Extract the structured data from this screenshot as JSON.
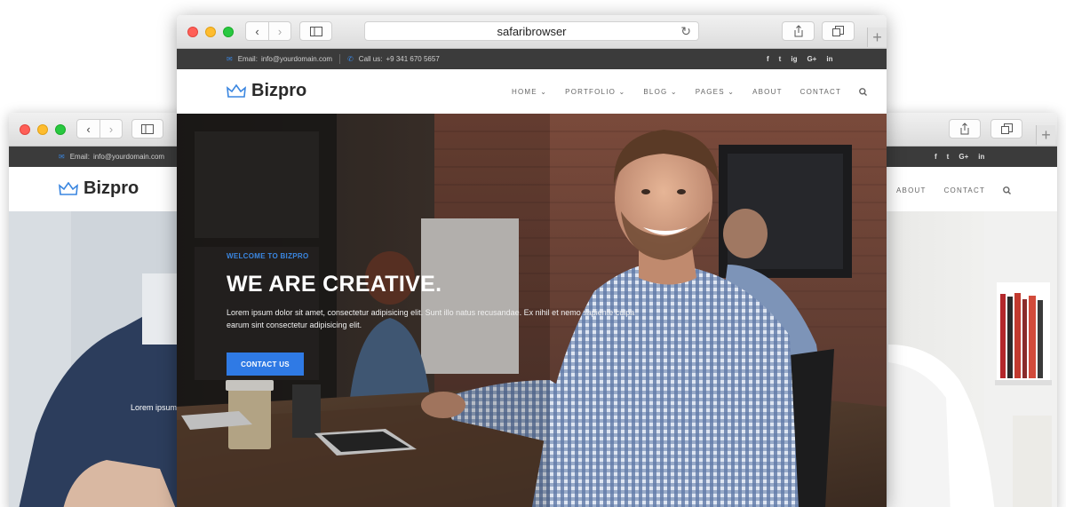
{
  "browser": {
    "address": "safaribrowser",
    "back_icon": "‹",
    "forward_icon": "›",
    "sidebar_icon": "sidebar-icon",
    "share_icon": "share-icon",
    "tabs_icon": "tabs-icon",
    "new_tab_icon": "+"
  },
  "topbar": {
    "email_label": "Email:",
    "email": "info@yourdomain.com",
    "call_label": "Call us:",
    "phone": "+9 341 670 5657",
    "social": [
      "f",
      "t",
      "ig",
      "G+",
      "in"
    ]
  },
  "site": {
    "logo_text": "Bizpro",
    "menu": [
      "HOME",
      "PORTFOLIO",
      "BLOG",
      "PAGES",
      "ABOUT",
      "CONTACT"
    ],
    "menu_dropdowns": [
      true,
      true,
      true,
      true,
      false,
      false
    ],
    "search_icon": "search-icon"
  },
  "hero": {
    "eyebrow": "WELCOME TO BIZPRO",
    "title": "WE ARE CREATIVE.",
    "text": "Lorem ipsum dolor sit amet, consectetur adipisicing elit. Sunt illo natus recusandae. Ex nihil et nemo sapiente culpa earum sint consectetur adipisicing elit.",
    "button": "CONTACT US"
  },
  "back_window": {
    "hero_text_fragment": "Lorem ipsum",
    "menu": [
      "ABOUT",
      "CONTACT"
    ]
  },
  "colors": {
    "accent": "#3a86e0",
    "button": "#2f7ae5",
    "topbar": "#3b3b3b"
  }
}
